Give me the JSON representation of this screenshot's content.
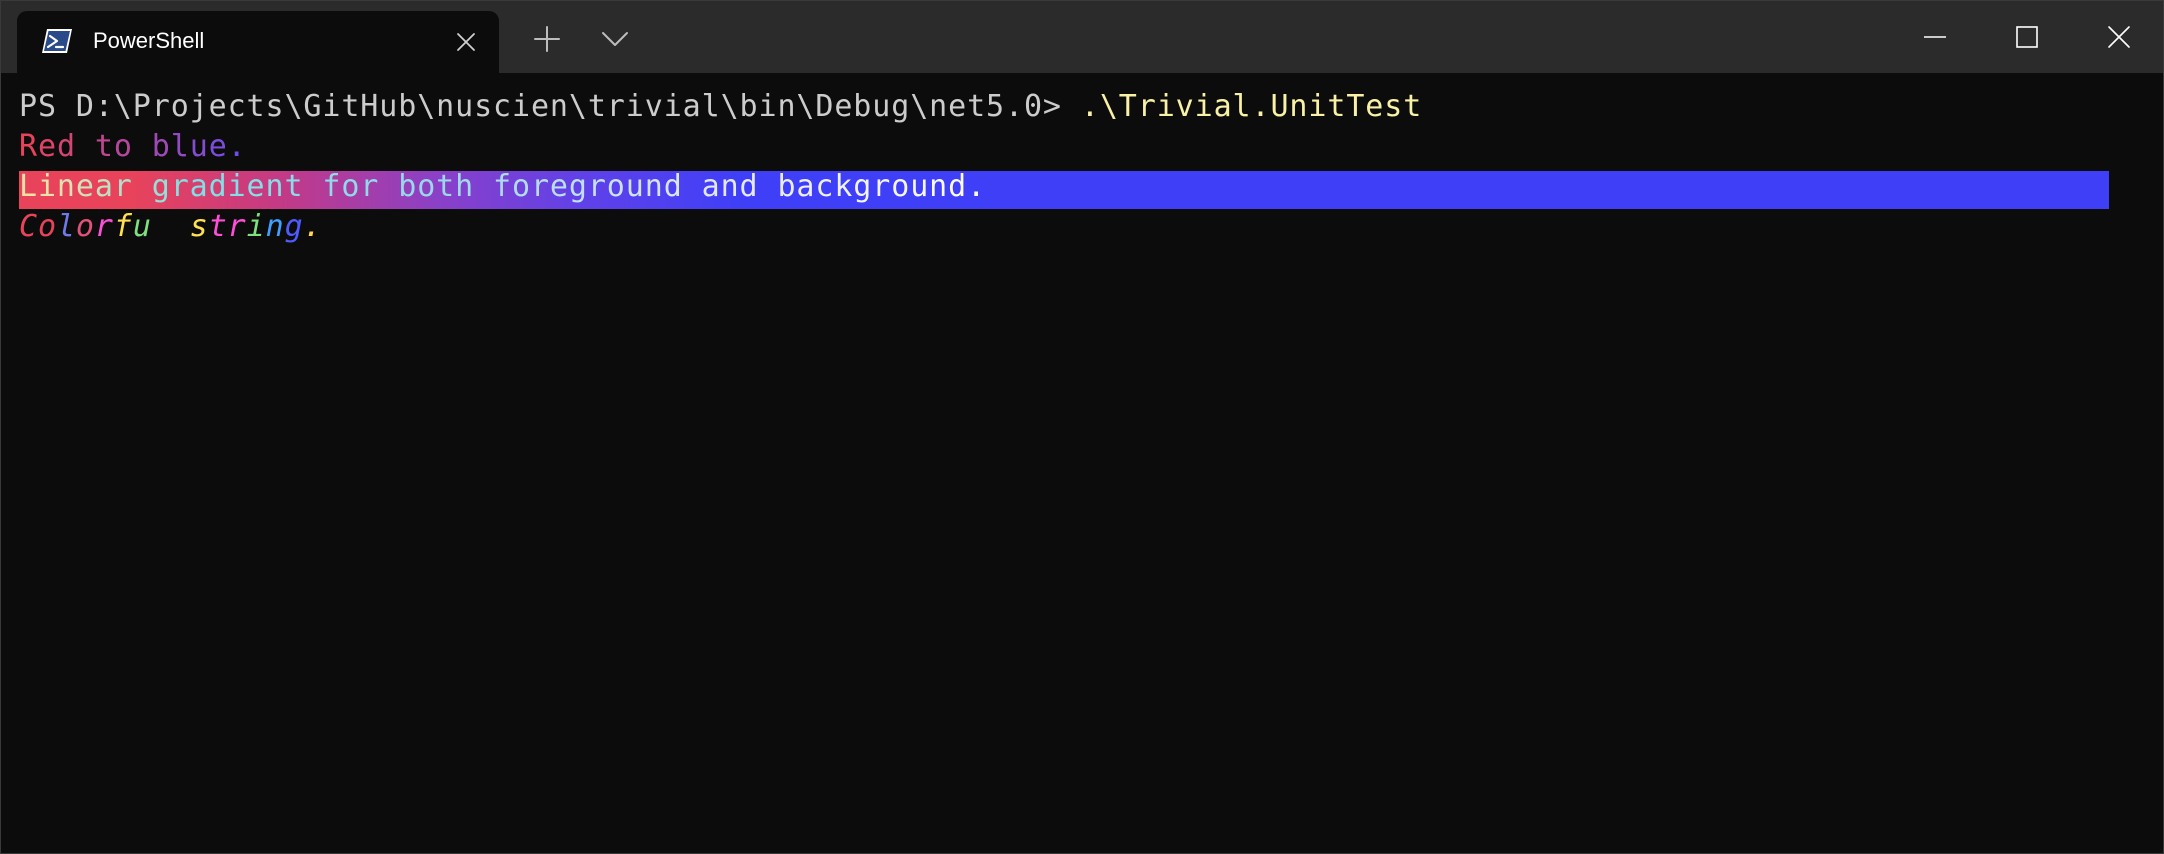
{
  "window": {
    "tab_title": "PowerShell",
    "tab_icon": "powershell-icon",
    "colors": {
      "titlebar": "#2b2b2b",
      "terminal_bg": "#0c0c0c",
      "prompt_text": "#cccccc",
      "command_text": "#f9f1a5",
      "gradient_start": "#e8435a",
      "gradient_end": "#3f3ff8"
    },
    "buttons": {
      "new_tab": "plus-icon",
      "dropdown": "chevron-down-icon",
      "minimize": "minimize-icon",
      "maximize": "maximize-icon",
      "close": "close-icon"
    }
  },
  "terminal": {
    "prompt": "PS D:\\Projects\\GitHub\\nuscien\\trivial\\bin\\Debug\\net5.0> ",
    "command": ".\\Trivial.UnitTest",
    "red_to_blue": "Red to blue.",
    "linear_gradient": "Linear gradient for both foreground and background.",
    "colorful": "Colorful string.",
    "red_to_blue_colors": [
      "#e8435a",
      "#df4468",
      "#d54574",
      "#cb4682",
      "#c0478f",
      "#b5489c",
      "#a949a9",
      "#9e4ab6",
      "#924bc2",
      "#864ccf",
      "#7a4ddc",
      "#6e4ee8"
    ],
    "colorful_colors": [
      "#e8435a",
      "#e8435a",
      "#6e7ae8",
      "#e0527a",
      "#ff4fd8",
      "#ffe14f",
      "#7fe07f",
      "#0c0c0c",
      "#ffe14f",
      "#ffe14f",
      "#ff4fd8",
      "#ff4fd8",
      "#7fe07f",
      "#3fa0ff",
      "#4f5bff",
      "#ffd84f"
    ]
  }
}
